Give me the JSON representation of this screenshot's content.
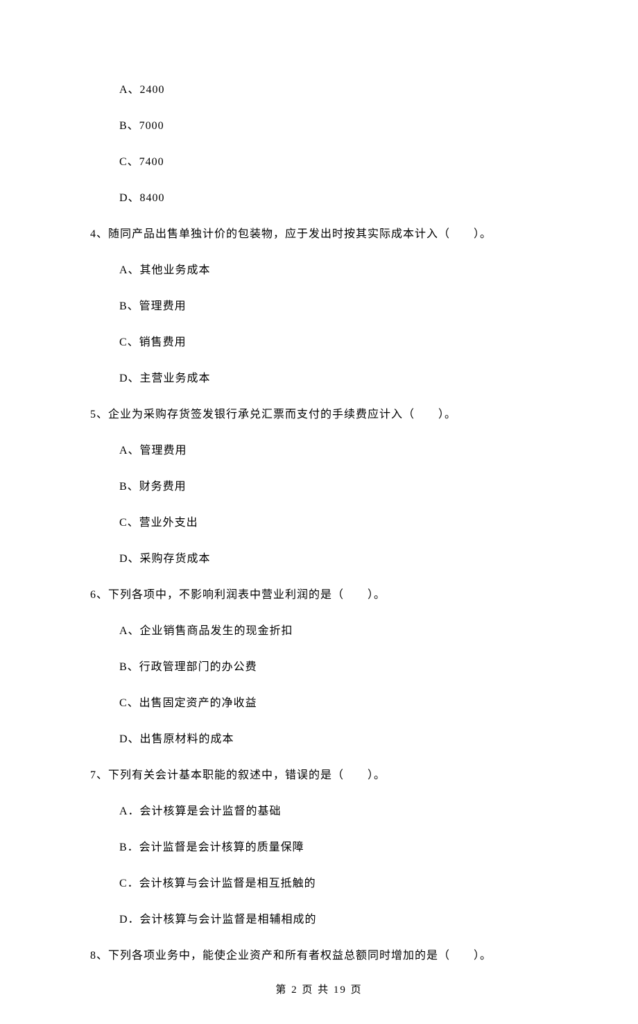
{
  "options_top": [
    "A、2400",
    "B、7000",
    "C、7400",
    "D、8400"
  ],
  "q4": {
    "text": "4、随同产品出售单独计价的包装物，应于发出时按其实际成本计入（　　）。",
    "options": [
      "A、其他业务成本",
      "B、管理费用",
      "C、销售费用",
      "D、主营业务成本"
    ]
  },
  "q5": {
    "text": "5、企业为采购存货签发银行承兑汇票而支付的手续费应计入（　　）。",
    "options": [
      "A、管理费用",
      "B、财务费用",
      "C、营业外支出",
      "D、采购存货成本"
    ]
  },
  "q6": {
    "text": "6、下列各项中，不影响利润表中营业利润的是（　　）。",
    "options": [
      "A、企业销售商品发生的现金折扣",
      "B、行政管理部门的办公费",
      "C、出售固定资产的净收益",
      "D、出售原材料的成本"
    ]
  },
  "q7": {
    "text": "7、下列有关会计基本职能的叙述中，错误的是（　　）。",
    "options": [
      "A．会计核算是会计监督的基础",
      "B．会计监督是会计核算的质量保障",
      "C．会计核算与会计监督是相互抵触的",
      "D．会计核算与会计监督是相辅相成的"
    ]
  },
  "q8": {
    "text": "8、下列各项业务中，能使企业资产和所有者权益总额同时增加的是（　　）。"
  },
  "footer": "第 2 页 共 19 页"
}
